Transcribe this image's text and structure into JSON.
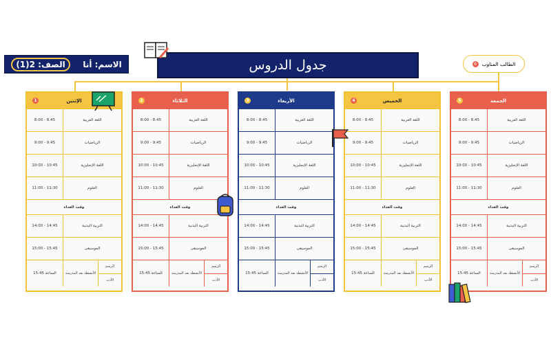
{
  "title": "جدول الدروس",
  "student": {
    "name_label": "الاسم: أنا",
    "grade_label": "الصف: 2(1)"
  },
  "hint_label": "الطالب المناوب",
  "hint_badge": "6",
  "colors": {
    "navy": "#13236b",
    "yellow": "#f5c542",
    "red": "#e8604c",
    "blue": "#1e3a8a"
  },
  "days": [
    {
      "name": "الإثنين",
      "badge": "1",
      "theme": "yellow",
      "times": [
        "8:00 - 8:45",
        "9:00 - 9:45",
        "10:00 - 10:45",
        "11:00 - 11:30"
      ],
      "subjects": [
        "اللغة العربية",
        "الرياضيات",
        "اللغة الإنجليزية",
        "العلوم"
      ],
      "break": "وقت الغداء",
      "times2": [
        "14:00 - 14:45",
        "15:00 - 15:45"
      ],
      "subjects2": [
        "التربية البدنية",
        "الموسيقى"
      ],
      "last": {
        "time": "15:45 الساعة",
        "activity": "الأنشطة بعد المدرسة",
        "top": "الرسم",
        "bottom": "الأدب"
      }
    },
    {
      "name": "الثلاثاء",
      "badge": "2",
      "theme": "red",
      "times": [
        "8:00 - 8:45",
        "9:00 - 9:45",
        "10:00 - 10:45",
        "11:00 - 11:30"
      ],
      "subjects": [
        "اللغة العربية",
        "الرياضيات",
        "اللغة الإنجليزية",
        "العلوم"
      ],
      "break": "وقت الغداء",
      "times2": [
        "14:00 - 14:45",
        "15:00 - 15:45"
      ],
      "subjects2": [
        "التربية البدنية",
        "الموسيقى"
      ],
      "last": {
        "time": "15:45 الساعة",
        "activity": "الأنشطة بعد المدرسة",
        "top": "الرسم",
        "bottom": "الأدب"
      }
    },
    {
      "name": "الأربعاء",
      "badge": "3",
      "theme": "blue",
      "times": [
        "8:00 - 8:45",
        "9:00 - 9:45",
        "10:00 - 10:45",
        "11:00 - 11:30"
      ],
      "subjects": [
        "اللغة العربية",
        "الرياضيات",
        "اللغة الإنجليزية",
        "العلوم"
      ],
      "break": "وقت الغداء",
      "times2": [
        "14:00 - 14:45",
        "15:00 - 15:45"
      ],
      "subjects2": [
        "التربية البدنية",
        "الموسيقى"
      ],
      "last": {
        "time": "15:45 الساعة",
        "activity": "الأنشطة بعد المدرسة",
        "top": "الرسم",
        "bottom": "الأدب"
      }
    },
    {
      "name": "الخميس",
      "badge": "4",
      "theme": "yellow",
      "times": [
        "8:00 - 8:45",
        "9:00 - 9:45",
        "10:00 - 10:45",
        "11:00 - 11:30"
      ],
      "subjects": [
        "اللغة العربية",
        "الرياضيات",
        "اللغة الإنجليزية",
        "العلوم"
      ],
      "break": "وقت الغداء",
      "times2": [
        "14:00 - 14:45",
        "15:00 - 15:45"
      ],
      "subjects2": [
        "التربية البدنية",
        "الموسيقى"
      ],
      "last": {
        "time": "15:45 الساعة",
        "activity": "الأنشطة بعد المدرسة",
        "top": "الرسم",
        "bottom": "الأدب"
      }
    },
    {
      "name": "الجمعة",
      "badge": "5",
      "theme": "red",
      "times": [
        "8:00 - 8:45",
        "9:00 - 9:45",
        "10:00 - 10:45",
        "11:00 - 11:30"
      ],
      "subjects": [
        "اللغة العربية",
        "الرياضيات",
        "اللغة الإنجليزية",
        "العلوم"
      ],
      "break": "وقت الغداء",
      "times2": [
        "14:00 - 14:45",
        "15:00 - 15:45"
      ],
      "subjects2": [
        "التربية البدنية",
        "الموسيقى"
      ],
      "last": {
        "time": "15:45 الساعة",
        "activity": "الأنشطة بعد المدرسة",
        "top": "الرسم",
        "bottom": "الأدب"
      }
    }
  ]
}
